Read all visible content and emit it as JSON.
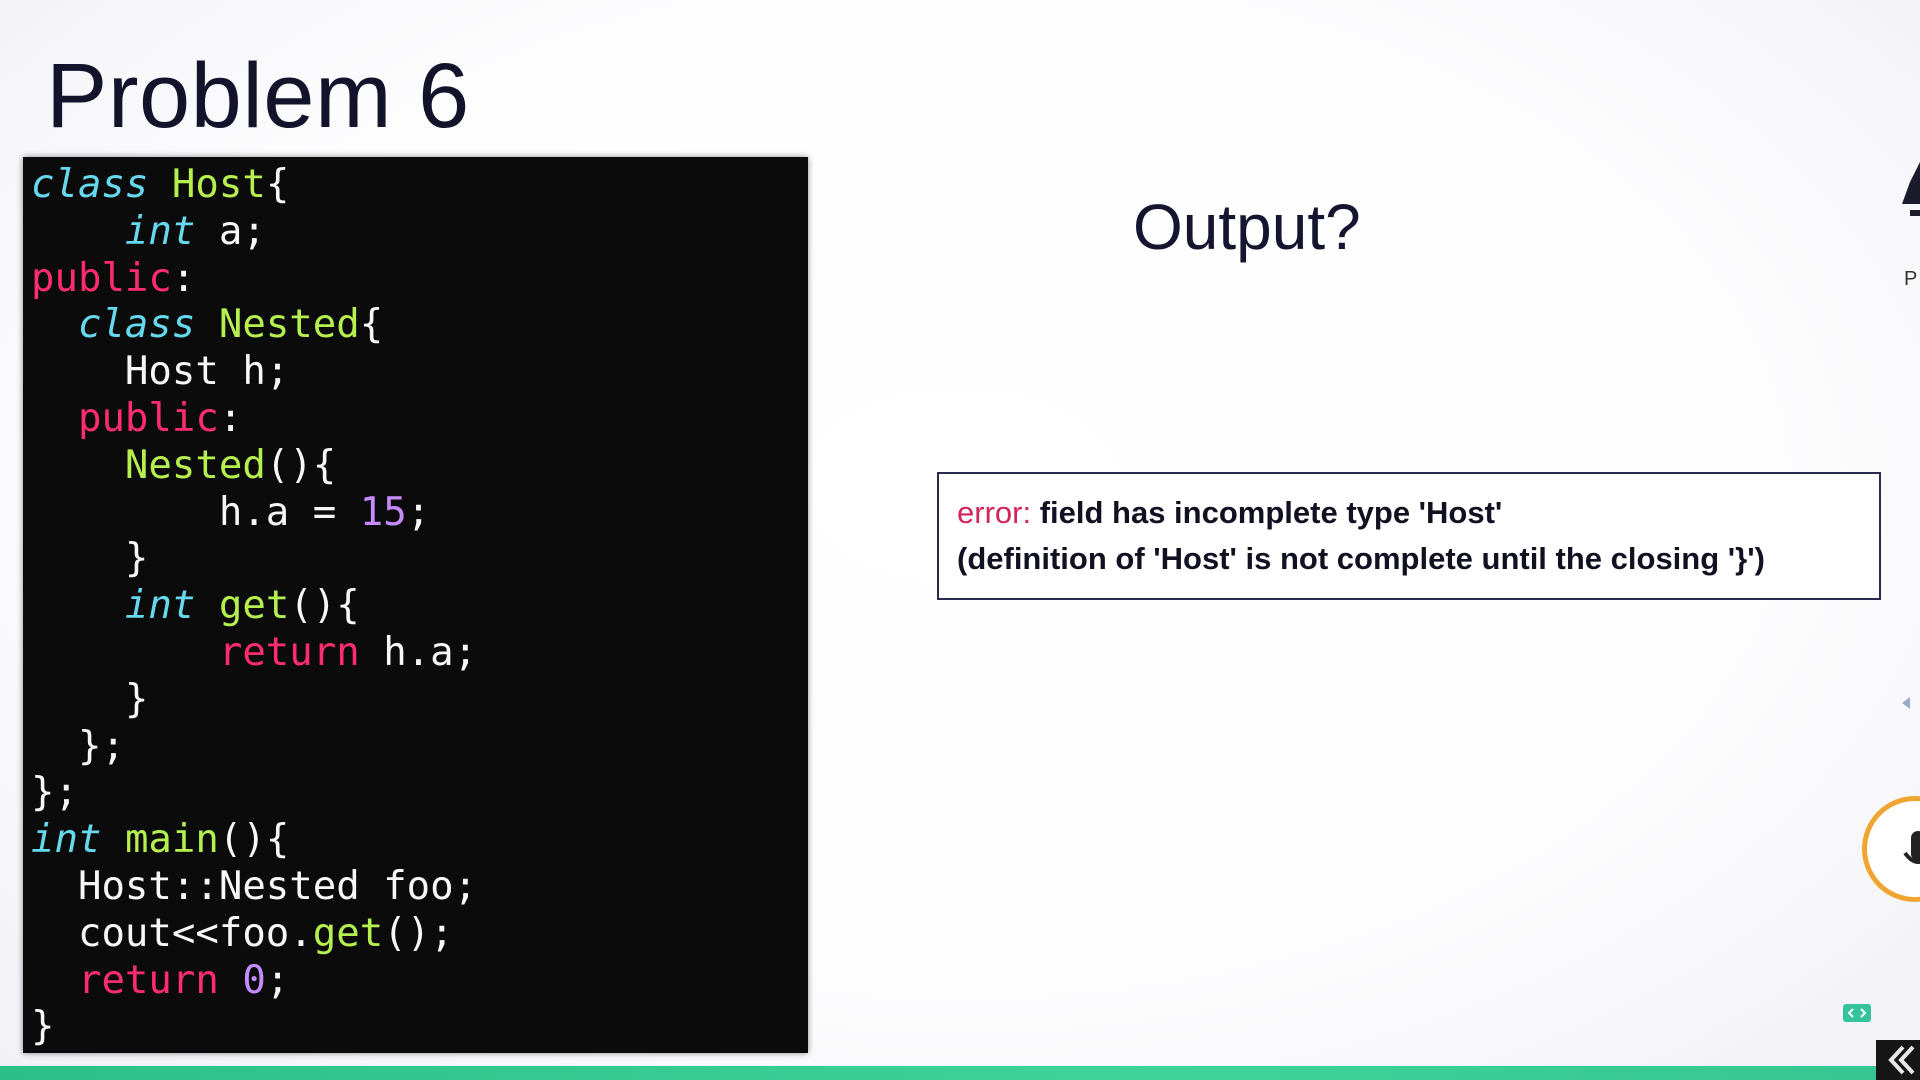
{
  "slide": {
    "title": "Problem 6",
    "question": "Output?",
    "error": {
      "label": "error:",
      "message": " field has incomplete type 'Host'",
      "detail": "(definition of 'Host' is not complete until the closing '}')"
    }
  },
  "code": {
    "language": "cpp",
    "lines": [
      "class Host{",
      "    int a;",
      "public:",
      "  class Nested{",
      "    Host h;",
      "  public:",
      "    Nested(){",
      "        h.a = 15;",
      "    }",
      "    int get(){",
      "        return h.a;",
      "    }",
      "  };",
      "};",
      "int main(){",
      "  Host::Nested foo;",
      "  cout<<foo.get();",
      "  return 0;",
      "}"
    ]
  },
  "overlay": {
    "edge_letter": "P",
    "embed_icon": "code-embed-icon",
    "mic_icon": "microphone-icon",
    "back_icon": "chevron-left-icon"
  },
  "colors": {
    "keyword_italic": "#66d9ef",
    "keyword_red": "#ff2d6f",
    "class_name": "#b6f04f",
    "number": "#c58cff",
    "error_label": "#d0265a",
    "bottom_bar": "#3fd39b",
    "mic_ring": "#f1a531"
  }
}
